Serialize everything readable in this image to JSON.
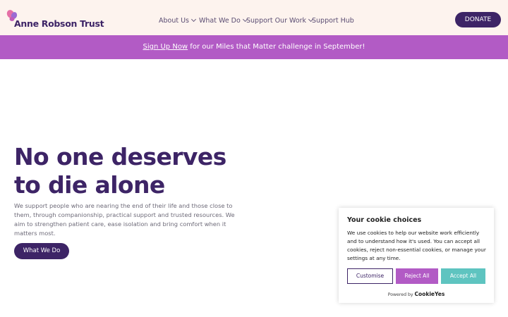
{
  "brand": {
    "name": "Anne Robson Trust"
  },
  "nav": {
    "items": [
      {
        "label": "About Us",
        "has_dropdown": true
      },
      {
        "label": "What We Do",
        "has_dropdown": true
      },
      {
        "label": "Support Our Work",
        "has_dropdown": true
      },
      {
        "label": "Support Hub",
        "has_dropdown": false
      }
    ],
    "donate_label": "DONATE"
  },
  "banner": {
    "link_text": "Sign Up Now",
    "text": " for our Miles that Matter challenge in September!"
  },
  "hero": {
    "title_line1": "No one deserves",
    "title_line2": "to die alone",
    "description": "We support people who are nearing the end of their life and those close to them, through companionship, practical support and trusted resources. We aim to strengthen patient care, ease isolation and bring comfort when it matters most.",
    "cta_label": "What We Do"
  },
  "cookie_banner": {
    "title": "Your cookie choices",
    "text": "We use cookies to help our website work efficiently and to understand how it's used. You can accept all cookies, reject non-essential cookies, or manage your settings at any time.",
    "customise_label": "Customise",
    "reject_label": "Reject All",
    "accept_label": "Accept All",
    "powered_prefix": "Powered by",
    "powered_brand": "CookieYes"
  },
  "colors": {
    "brand_purple": "#3d2466",
    "banner_magenta": "#b25bc5",
    "accept_teal": "#5ec4c0",
    "header_bg": "#fdf3ee"
  }
}
